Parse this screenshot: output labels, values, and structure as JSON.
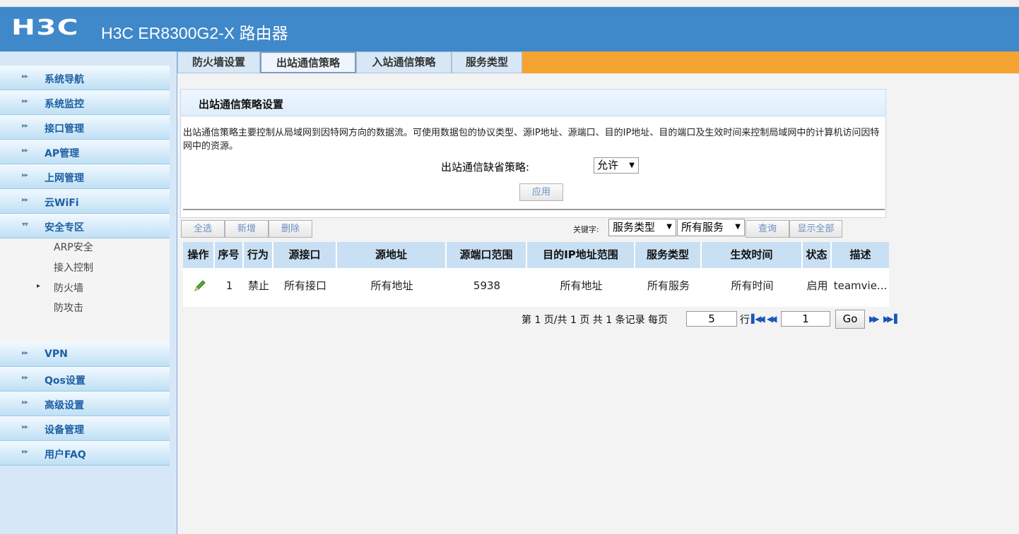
{
  "header": {
    "logo": "H3C",
    "title": "H3C ER8300G2-X 路由器"
  },
  "sidebar": {
    "items": [
      {
        "label": "系统导航"
      },
      {
        "label": "系统监控"
      },
      {
        "label": "接口管理"
      },
      {
        "label": "AP管理"
      },
      {
        "label": "上网管理"
      },
      {
        "label": "云WiFi"
      },
      {
        "label": "安全专区"
      }
    ],
    "sub_items": [
      {
        "label": "ARP安全"
      },
      {
        "label": "接入控制"
      },
      {
        "label": "防火墙"
      },
      {
        "label": "防攻击"
      }
    ],
    "items_after": [
      {
        "label": "VPN"
      },
      {
        "label": "Qos设置"
      },
      {
        "label": "高级设置"
      },
      {
        "label": "设备管理"
      },
      {
        "label": "用户FAQ"
      }
    ]
  },
  "tabs": [
    {
      "label": "防火墙设置"
    },
    {
      "label": "出站通信策略"
    },
    {
      "label": "入站通信策略"
    },
    {
      "label": "服务类型"
    }
  ],
  "panel": {
    "title": "出站通信策略设置",
    "description": "出站通信策略主要控制从局域网到因特网方向的数据流。可使用数据包的协议类型、源IP地址、源端口、目的IP地址、目的端口及生效时间来控制局域网中的计算机访问因特网中的资源。",
    "policy_label": "出站通信缺省策略:",
    "policy_value": "允许",
    "apply_label": "应用"
  },
  "toolbar": {
    "select_all": "全选",
    "add": "新增",
    "delete": "删除",
    "keyword_label": "关键字:",
    "keyword_field": "服务类型",
    "keyword_value": "所有服务",
    "query": "查询",
    "show_all": "显示全部"
  },
  "table": {
    "columns": [
      "操作",
      "序号",
      "行为",
      "源接口",
      "源地址",
      "源端口范围",
      "目的IP地址范围",
      "服务类型",
      "生效时间",
      "状态",
      "描述"
    ],
    "rows": [
      {
        "index": "1",
        "action": "禁止",
        "src_if": "所有接口",
        "src_addr": "所有地址",
        "src_port": "5938",
        "dst_ip": "所有地址",
        "service": "所有服务",
        "time": "所有时间",
        "status": "启用",
        "desc": "teamvie..."
      }
    ]
  },
  "pager": {
    "summary": "第 1 页/共 1 页 共 1 条记录 每页",
    "per_page": "5",
    "rows_label": "行",
    "page_input": "1",
    "go": "Go"
  },
  "colors": {
    "header": "#3f88c9",
    "tab_bar": "#f5a431",
    "table_header": "#c9dff3"
  }
}
